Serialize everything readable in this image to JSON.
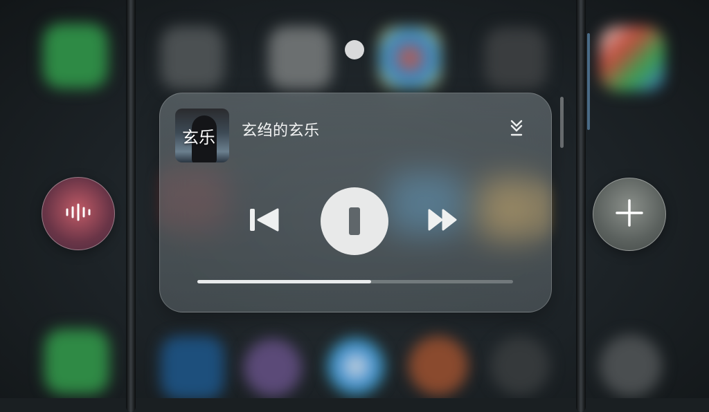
{
  "player": {
    "cover_text": "玄乐",
    "track_title": "玄绉的玄乐",
    "progress_fraction": 0.55
  },
  "icons": {
    "collapse": "chevron-double-down-icon",
    "prev": "skip-previous-icon",
    "play_pause": "pause-icon",
    "next": "skip-next-icon",
    "voice": "voice-wave-icon",
    "add": "plus-icon"
  },
  "colors": {
    "card_bg": "#6b7478",
    "button_face": "#e8e9e9",
    "progress_fill": "#e9ebec"
  }
}
